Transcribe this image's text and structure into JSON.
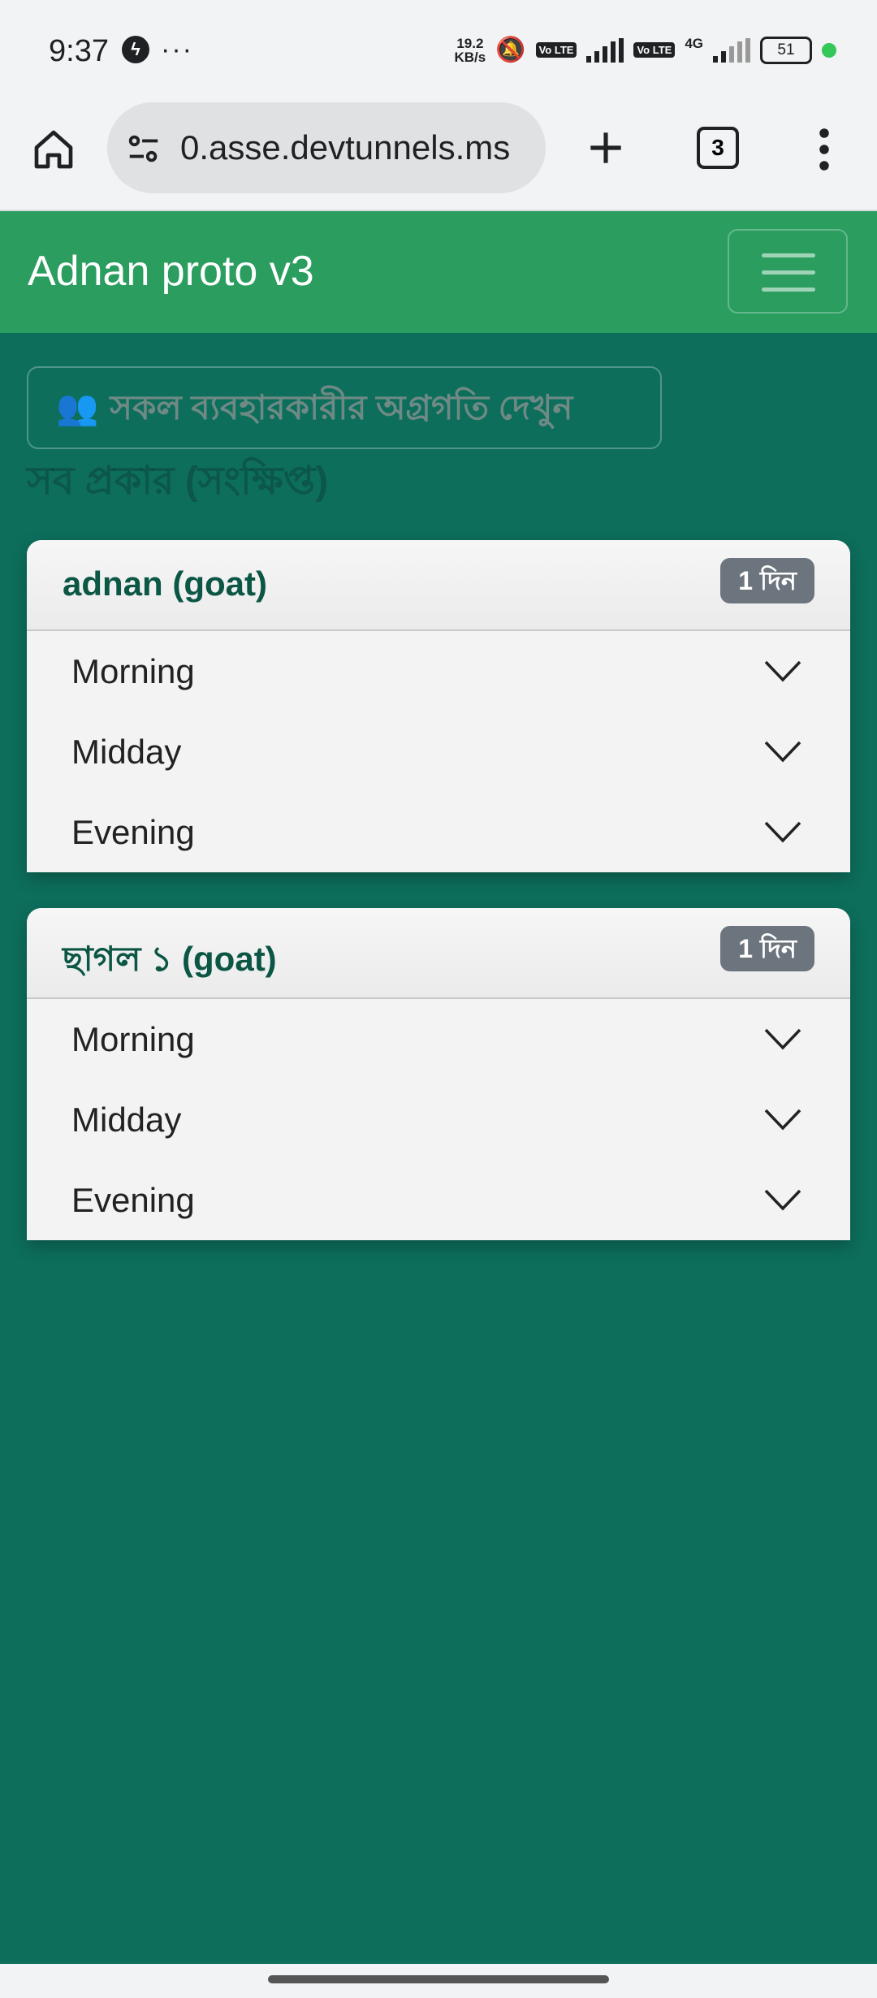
{
  "status_bar": {
    "time": "9:37",
    "speed_value": "19.2",
    "speed_unit": "KB/s",
    "volte_1": "Vo LTE",
    "volte_2": "Vo LTE",
    "network": "4G",
    "battery": "51",
    "icons": [
      "messenger-icon",
      "more-dots-icon",
      "mute-icon",
      "signal-icon",
      "battery-icon"
    ]
  },
  "browser": {
    "url": "0.asse.devtunnels.ms",
    "tab_count": "3",
    "icons": [
      "home-icon",
      "site-settings-icon",
      "new-tab-icon",
      "tab-switcher-icon",
      "menu-icon"
    ]
  },
  "app": {
    "brand": "Adnan proto v3",
    "view_all_button": "সকল ব্যবহারকারীর অগ্রগতি দেখুন",
    "view_all_icon": "👥",
    "ghost_title": "সব প্রকার (সংক্ষিপ্ত)"
  },
  "cards": [
    {
      "title": "adnan (goat)",
      "badge": "1 দিন",
      "items": [
        {
          "label": "Morning"
        },
        {
          "label": "Midday"
        },
        {
          "label": "Evening"
        }
      ]
    },
    {
      "title": "ছাগল ১ (goat)",
      "badge": "1 দিন",
      "items": [
        {
          "label": "Morning"
        },
        {
          "label": "Midday"
        },
        {
          "label": "Evening"
        }
      ]
    }
  ],
  "colors": {
    "navbar": "#2a9d5f",
    "background": "#0d6e5c",
    "card_title": "#0b5645",
    "badge": "#6c757d"
  }
}
